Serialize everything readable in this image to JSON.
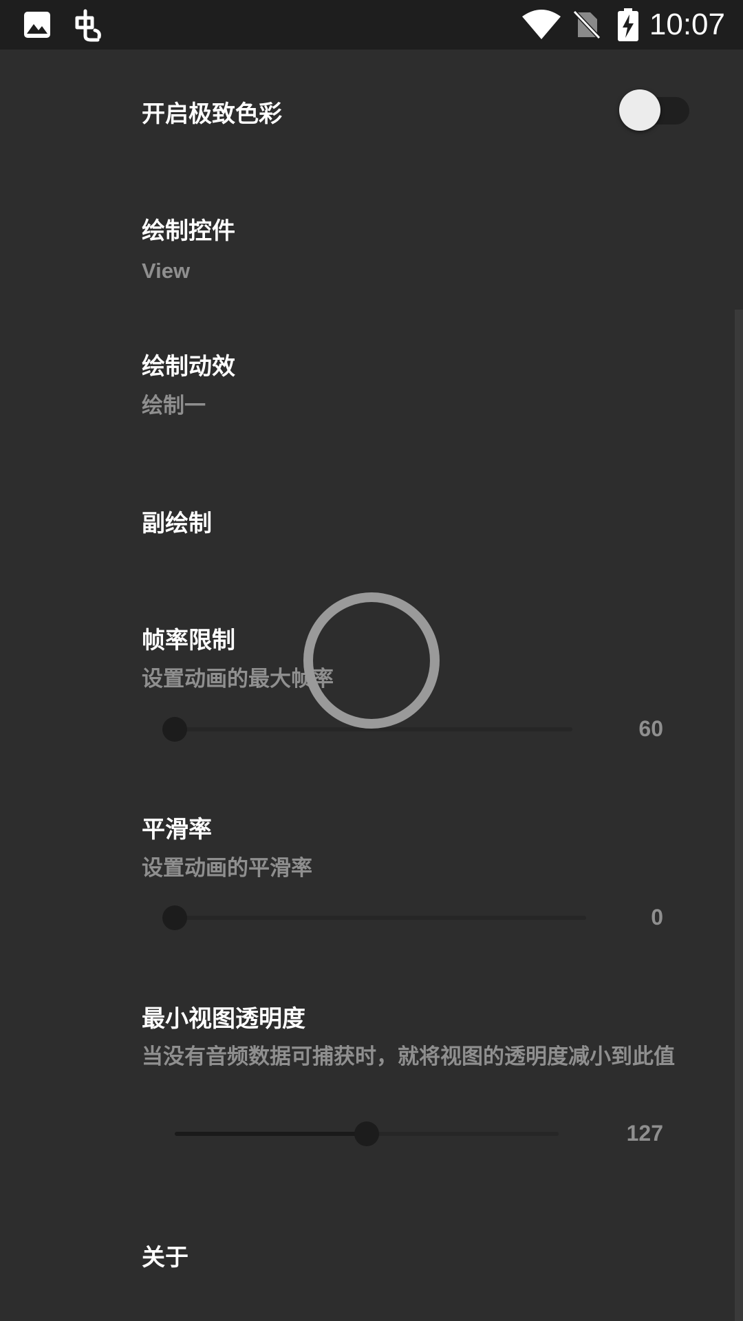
{
  "status_bar": {
    "time": "10:07",
    "left_icons": [
      "image-icon",
      "app-logo-icon"
    ],
    "right_icons": [
      "wifi-icon",
      "no-sim-icon",
      "battery-charging-icon"
    ]
  },
  "settings": {
    "extreme_color": {
      "title": "开启极致色彩",
      "enabled": false
    },
    "draw_widget": {
      "title": "绘制控件",
      "summary": "View"
    },
    "draw_effect": {
      "title": "绘制动效",
      "summary": "绘制一"
    },
    "sub_draw": {
      "title": "副绘制"
    },
    "frame_rate": {
      "title": "帧率限制",
      "summary": "设置动画的最大帧率",
      "value": "60",
      "level": 0.0
    },
    "smoothness": {
      "title": "平滑率",
      "summary": "设置动画的平滑率",
      "value": "0",
      "level": 0.0
    },
    "min_opacity": {
      "title": "最小视图透明度",
      "summary": "当没有音频数据可捕获时，就将视图的透明度减小到此值",
      "value": "127",
      "level": 0.5
    },
    "about": {
      "title": "关于"
    }
  },
  "colors": {
    "background": "#2d2d2d",
    "status_bar": "#1e1e1e",
    "title_text": "#ffffff",
    "summary_text": "#8f8f8f"
  }
}
